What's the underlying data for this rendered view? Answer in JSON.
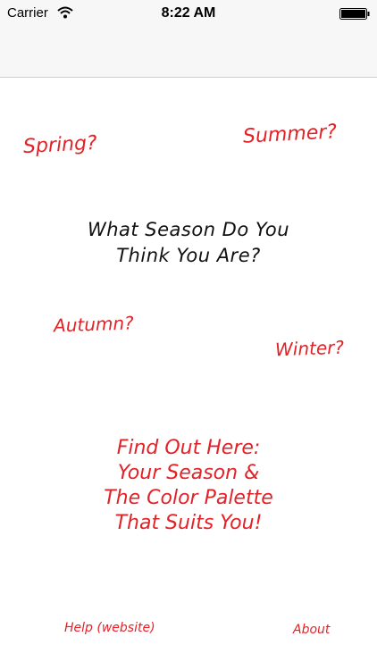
{
  "status_bar": {
    "carrier": "Carrier",
    "time": "8:22 AM",
    "wifi_icon": "wifi-icon",
    "battery_icon": "battery-icon"
  },
  "seasons": {
    "spring": "Spring?",
    "summer": "Summer?",
    "autumn": "Autumn?",
    "winter": "Winter?"
  },
  "question": {
    "line1": "What Season Do You",
    "line2": "Think You Are?"
  },
  "cta": {
    "line1": "Find Out Here:",
    "line2": "Your Season &",
    "line3": "The Color Palette",
    "line4": "That Suits You!"
  },
  "footer": {
    "help_label": "Help (website)",
    "about_label": "About"
  },
  "colors": {
    "accent_red": "#e32228",
    "text_black": "#111111",
    "bar_background": "#f7f7f7"
  }
}
